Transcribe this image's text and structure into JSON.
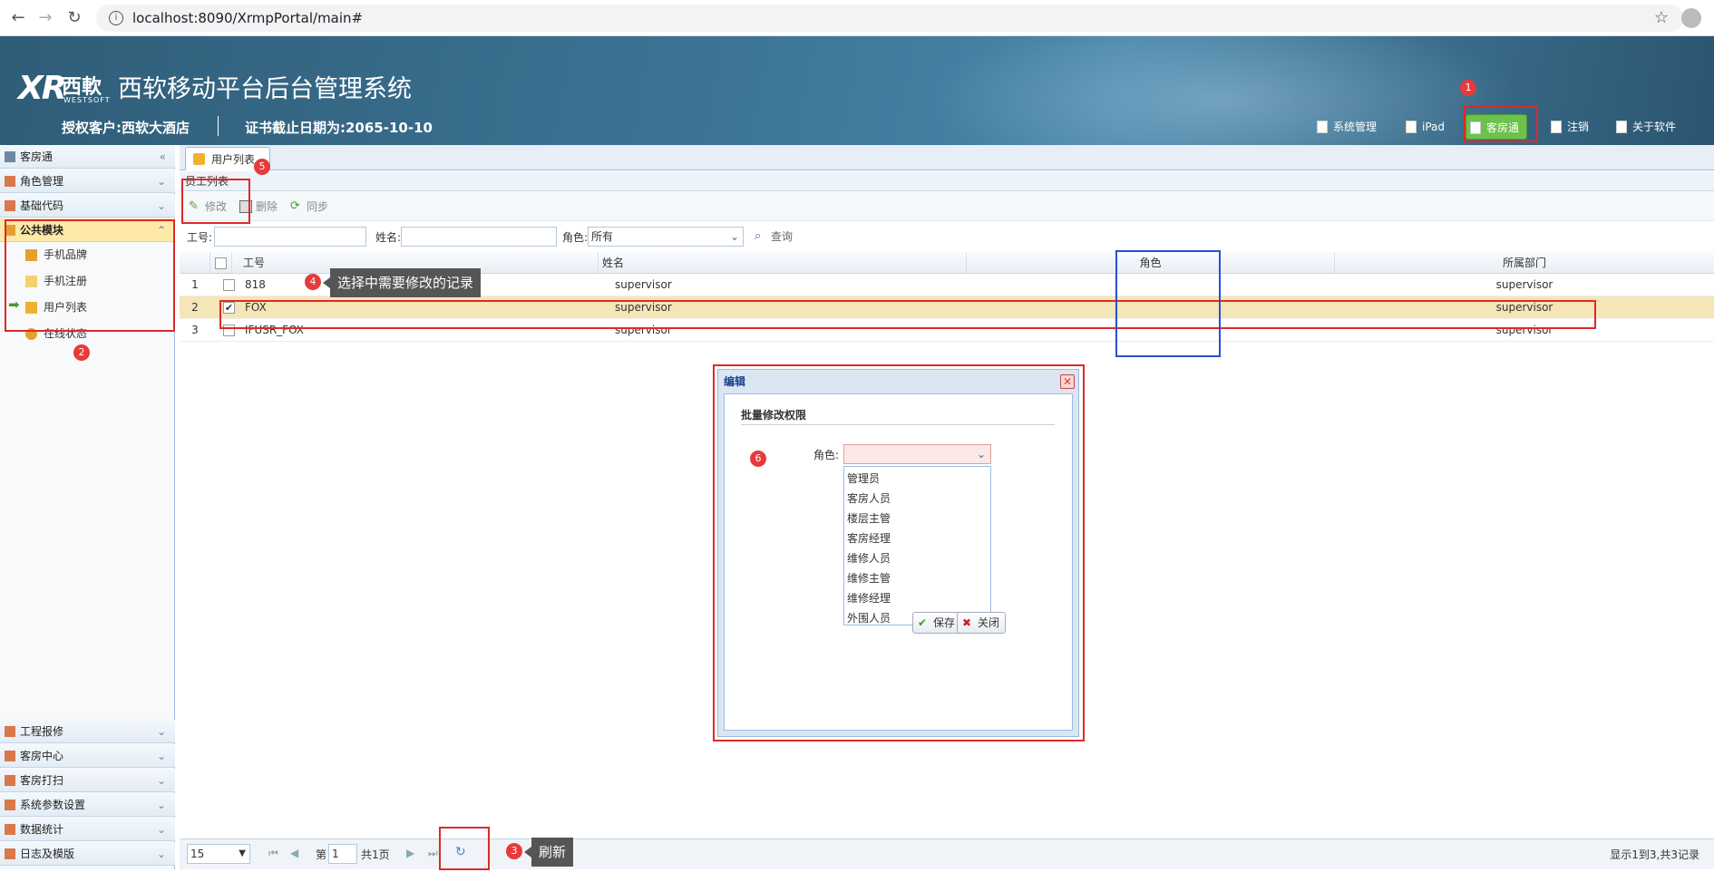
{
  "browser": {
    "url": "localhost:8090/XrmpPortal/main#"
  },
  "header": {
    "logo_mark": "XR",
    "logo_cn": "西軟",
    "logo_en": "WESTSOFT",
    "title": "西软移动平台后台管理系统",
    "client": "授权客户:西软大酒店",
    "expire": "证书截止日期为:2065-10-10",
    "buttons": [
      "系统管理",
      "iPad",
      "客房通",
      "注销",
      "关于软件"
    ]
  },
  "sidebar": {
    "top": [
      "客房通",
      "角色管理",
      "基础代码",
      "公共模块"
    ],
    "sub": [
      "手机品牌",
      "手机注册",
      "用户列表",
      "在线状态"
    ],
    "bottom": [
      "工程报修",
      "客房中心",
      "客房打扫",
      "系统参数设置",
      "数据统计",
      "日志及模版"
    ]
  },
  "tab": {
    "label": "用户列表"
  },
  "panel": {
    "title": "员工列表"
  },
  "toolbar": {
    "edit": "修改",
    "delete": "删除",
    "sync": "同步"
  },
  "filters": {
    "id_label": "工号:",
    "name_label": "姓名:",
    "role_label": "角色:",
    "role_value": "所有",
    "query": "查询"
  },
  "grid": {
    "headers": [
      "工号",
      "姓名",
      "角色",
      "所属部门"
    ],
    "rows": [
      {
        "no": "1",
        "id": "818",
        "name": "supervisor",
        "role": "",
        "dept": "supervisor",
        "checked": false
      },
      {
        "no": "2",
        "id": "FOX",
        "name": "supervisor",
        "role": "",
        "dept": "supervisor",
        "checked": true
      },
      {
        "no": "3",
        "id": "IFUSR_FOX",
        "name": "supervisor",
        "role": "",
        "dept": "supervisor",
        "checked": false
      }
    ]
  },
  "pager": {
    "page_size": "15",
    "page_prefix": "第",
    "page": "1",
    "page_total": "共1页",
    "summary": "显示1到3,共3记录"
  },
  "dialog": {
    "title": "编辑",
    "section": "批量修改权限",
    "role_label": "角色:",
    "options": [
      "管理员",
      "客房人员",
      "楼层主管",
      "客房经理",
      "维修人员",
      "维修主管",
      "维修经理",
      "外围人员"
    ],
    "save": "保存",
    "close": "关闭"
  },
  "annotations": {
    "badges": [
      "1",
      "2",
      "3",
      "4",
      "5",
      "6"
    ],
    "tip_select": "选择中需要修改的记录",
    "tip_refresh": "刷新"
  },
  "colors": {
    "active_button": "#6cc24a",
    "annotation_red": "#e02828",
    "annotation_blue": "#2a4fd0",
    "selected_row": "#f5e6b8"
  }
}
